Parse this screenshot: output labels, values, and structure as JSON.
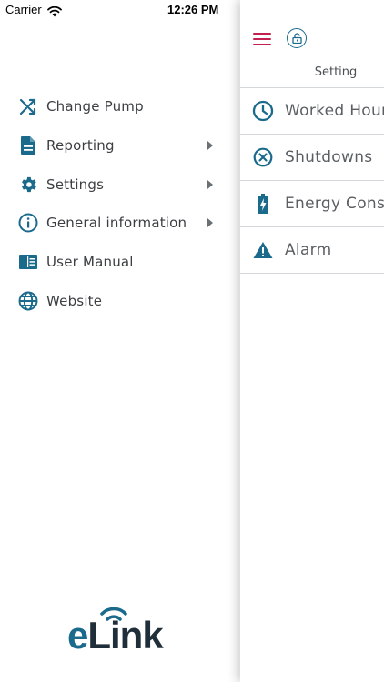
{
  "status_bar": {
    "carrier": "Carrier",
    "time": "12:26 PM"
  },
  "menu": {
    "items": [
      {
        "label": "Change Pump",
        "icon": "shuffle-icon",
        "has_submenu": false
      },
      {
        "label": "Reporting",
        "icon": "document-icon",
        "has_submenu": true
      },
      {
        "label": "Settings",
        "icon": "gear-icon",
        "has_submenu": true
      },
      {
        "label": "General information",
        "icon": "info-icon",
        "has_submenu": true
      },
      {
        "label": "User Manual",
        "icon": "book-icon",
        "has_submenu": false
      },
      {
        "label": "Website",
        "icon": "globe-icon",
        "has_submenu": false
      }
    ]
  },
  "logo": {
    "text_e": "e",
    "text_rest": "Link"
  },
  "panel": {
    "title": "Setting",
    "items": [
      {
        "label": "Worked Hours",
        "icon": "clock-icon"
      },
      {
        "label": "Shutdowns",
        "icon": "circle-x-icon"
      },
      {
        "label": "Energy Consumption",
        "icon": "battery-charging-icon"
      },
      {
        "label": "Alarm",
        "icon": "warning-icon"
      }
    ]
  },
  "colors": {
    "accent_blue": "#1a6a8c",
    "accent_red": "#c4204f",
    "text": "#3b3f42"
  }
}
